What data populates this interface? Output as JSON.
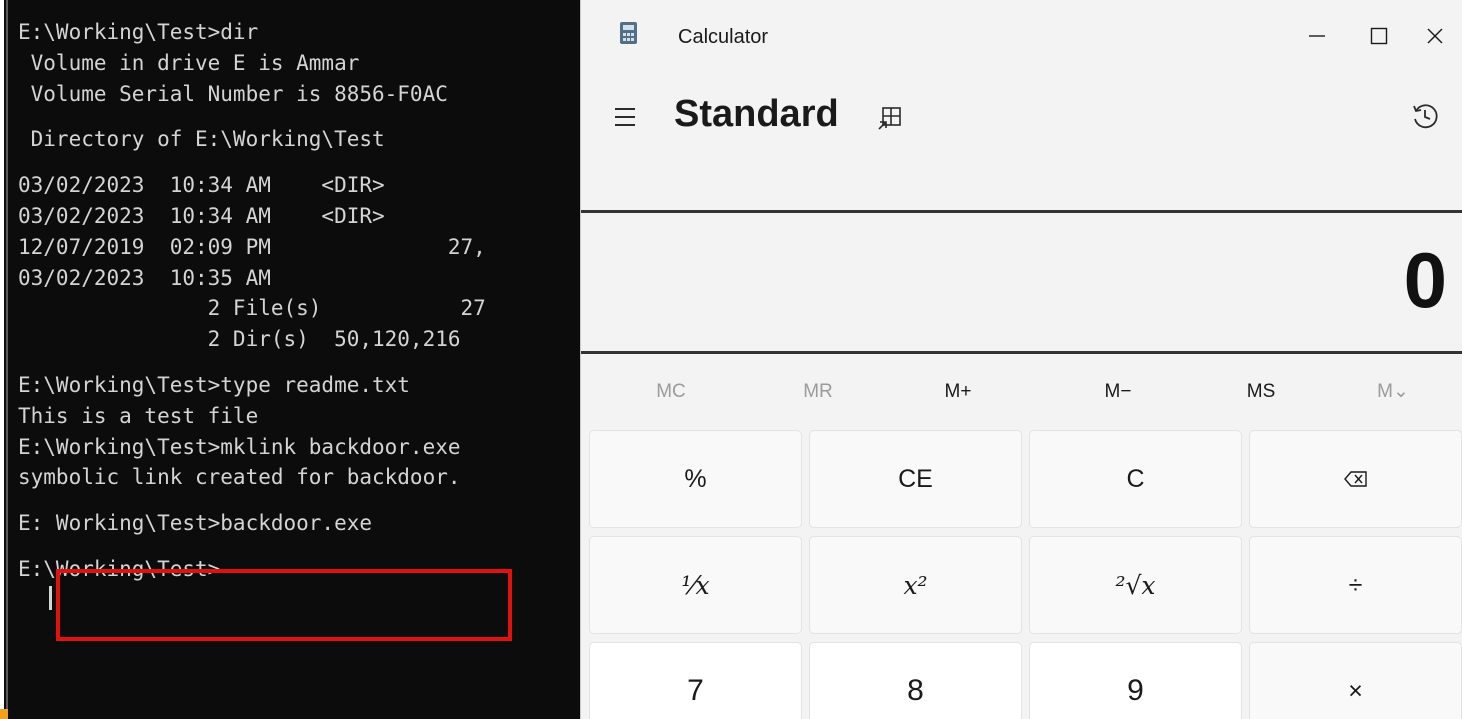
{
  "terminal": {
    "lines": [
      "E:\\Working\\Test>dir",
      " Volume in drive E is Ammar",
      " Volume Serial Number is 8856-F0AC",
      " Directory of E:\\Working\\Test",
      "03/02/2023  10:34 AM    <DIR>",
      "03/02/2023  10:34 AM    <DIR>",
      "12/07/2019  02:09 PM              27,",
      "03/02/2023  10:35 AM",
      "               2 File(s)           27",
      "               2 Dir(s)  50,120,216",
      "E:\\Working\\Test>type readme.txt",
      "This is a test file",
      "E:\\Working\\Test>mklink backdoor.exe",
      "symbolic link created for backdoor.",
      "E: Working\\Test>backdoor.exe",
      "E:\\Working\\Test>"
    ]
  },
  "calculator": {
    "window_title": "Calculator",
    "mode": "Standard",
    "display": "0",
    "memory_buttons": [
      "MC",
      "MR",
      "M+",
      "M−",
      "MS",
      "M⌄"
    ],
    "keys_row1": [
      "%",
      "CE",
      "C",
      "⌫"
    ],
    "keys_row2": [
      "⅟x",
      "x²",
      "²√x",
      "÷"
    ],
    "keys_row3": [
      "7",
      "8",
      "9",
      "×"
    ],
    "icons": {
      "menu": "hamburger-icon",
      "keep_on_top": "keep-on-top-icon",
      "history": "history-icon",
      "minimize": "minimize-icon",
      "maximize": "maximize-icon",
      "close": "close-icon"
    }
  },
  "colors": {
    "terminal_bg": "#0c0c0c",
    "terminal_text": "#d4d4d4",
    "highlight": "#e0120f",
    "calc_bg": "#f3f3f3"
  }
}
